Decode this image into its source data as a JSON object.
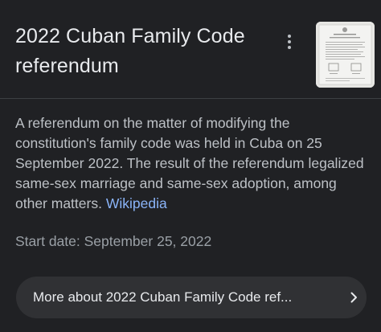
{
  "header": {
    "title_line1": "2022 Cuban Family Code",
    "title_line2": "referendum",
    "more_menu_icon": "more-vert-icon",
    "thumbnail_icon": "document-thumbnail"
  },
  "description": {
    "text": "A referendum on the matter of modifying the constitution's family code was held in Cuba on 25 September 2022. The result of the referendum legalized same-sex marriage and same-sex adoption, among other matters.",
    "source_link": "Wikipedia"
  },
  "facts": {
    "start_date_label": "Start date:",
    "start_date_value": "September 25, 2022"
  },
  "more_button": {
    "label": "More about 2022 Cuban Family Code ref...",
    "icon": "chevron-right-icon"
  },
  "colors": {
    "background": "#202124",
    "link": "#8ab4f8",
    "button_bg": "#303134"
  }
}
